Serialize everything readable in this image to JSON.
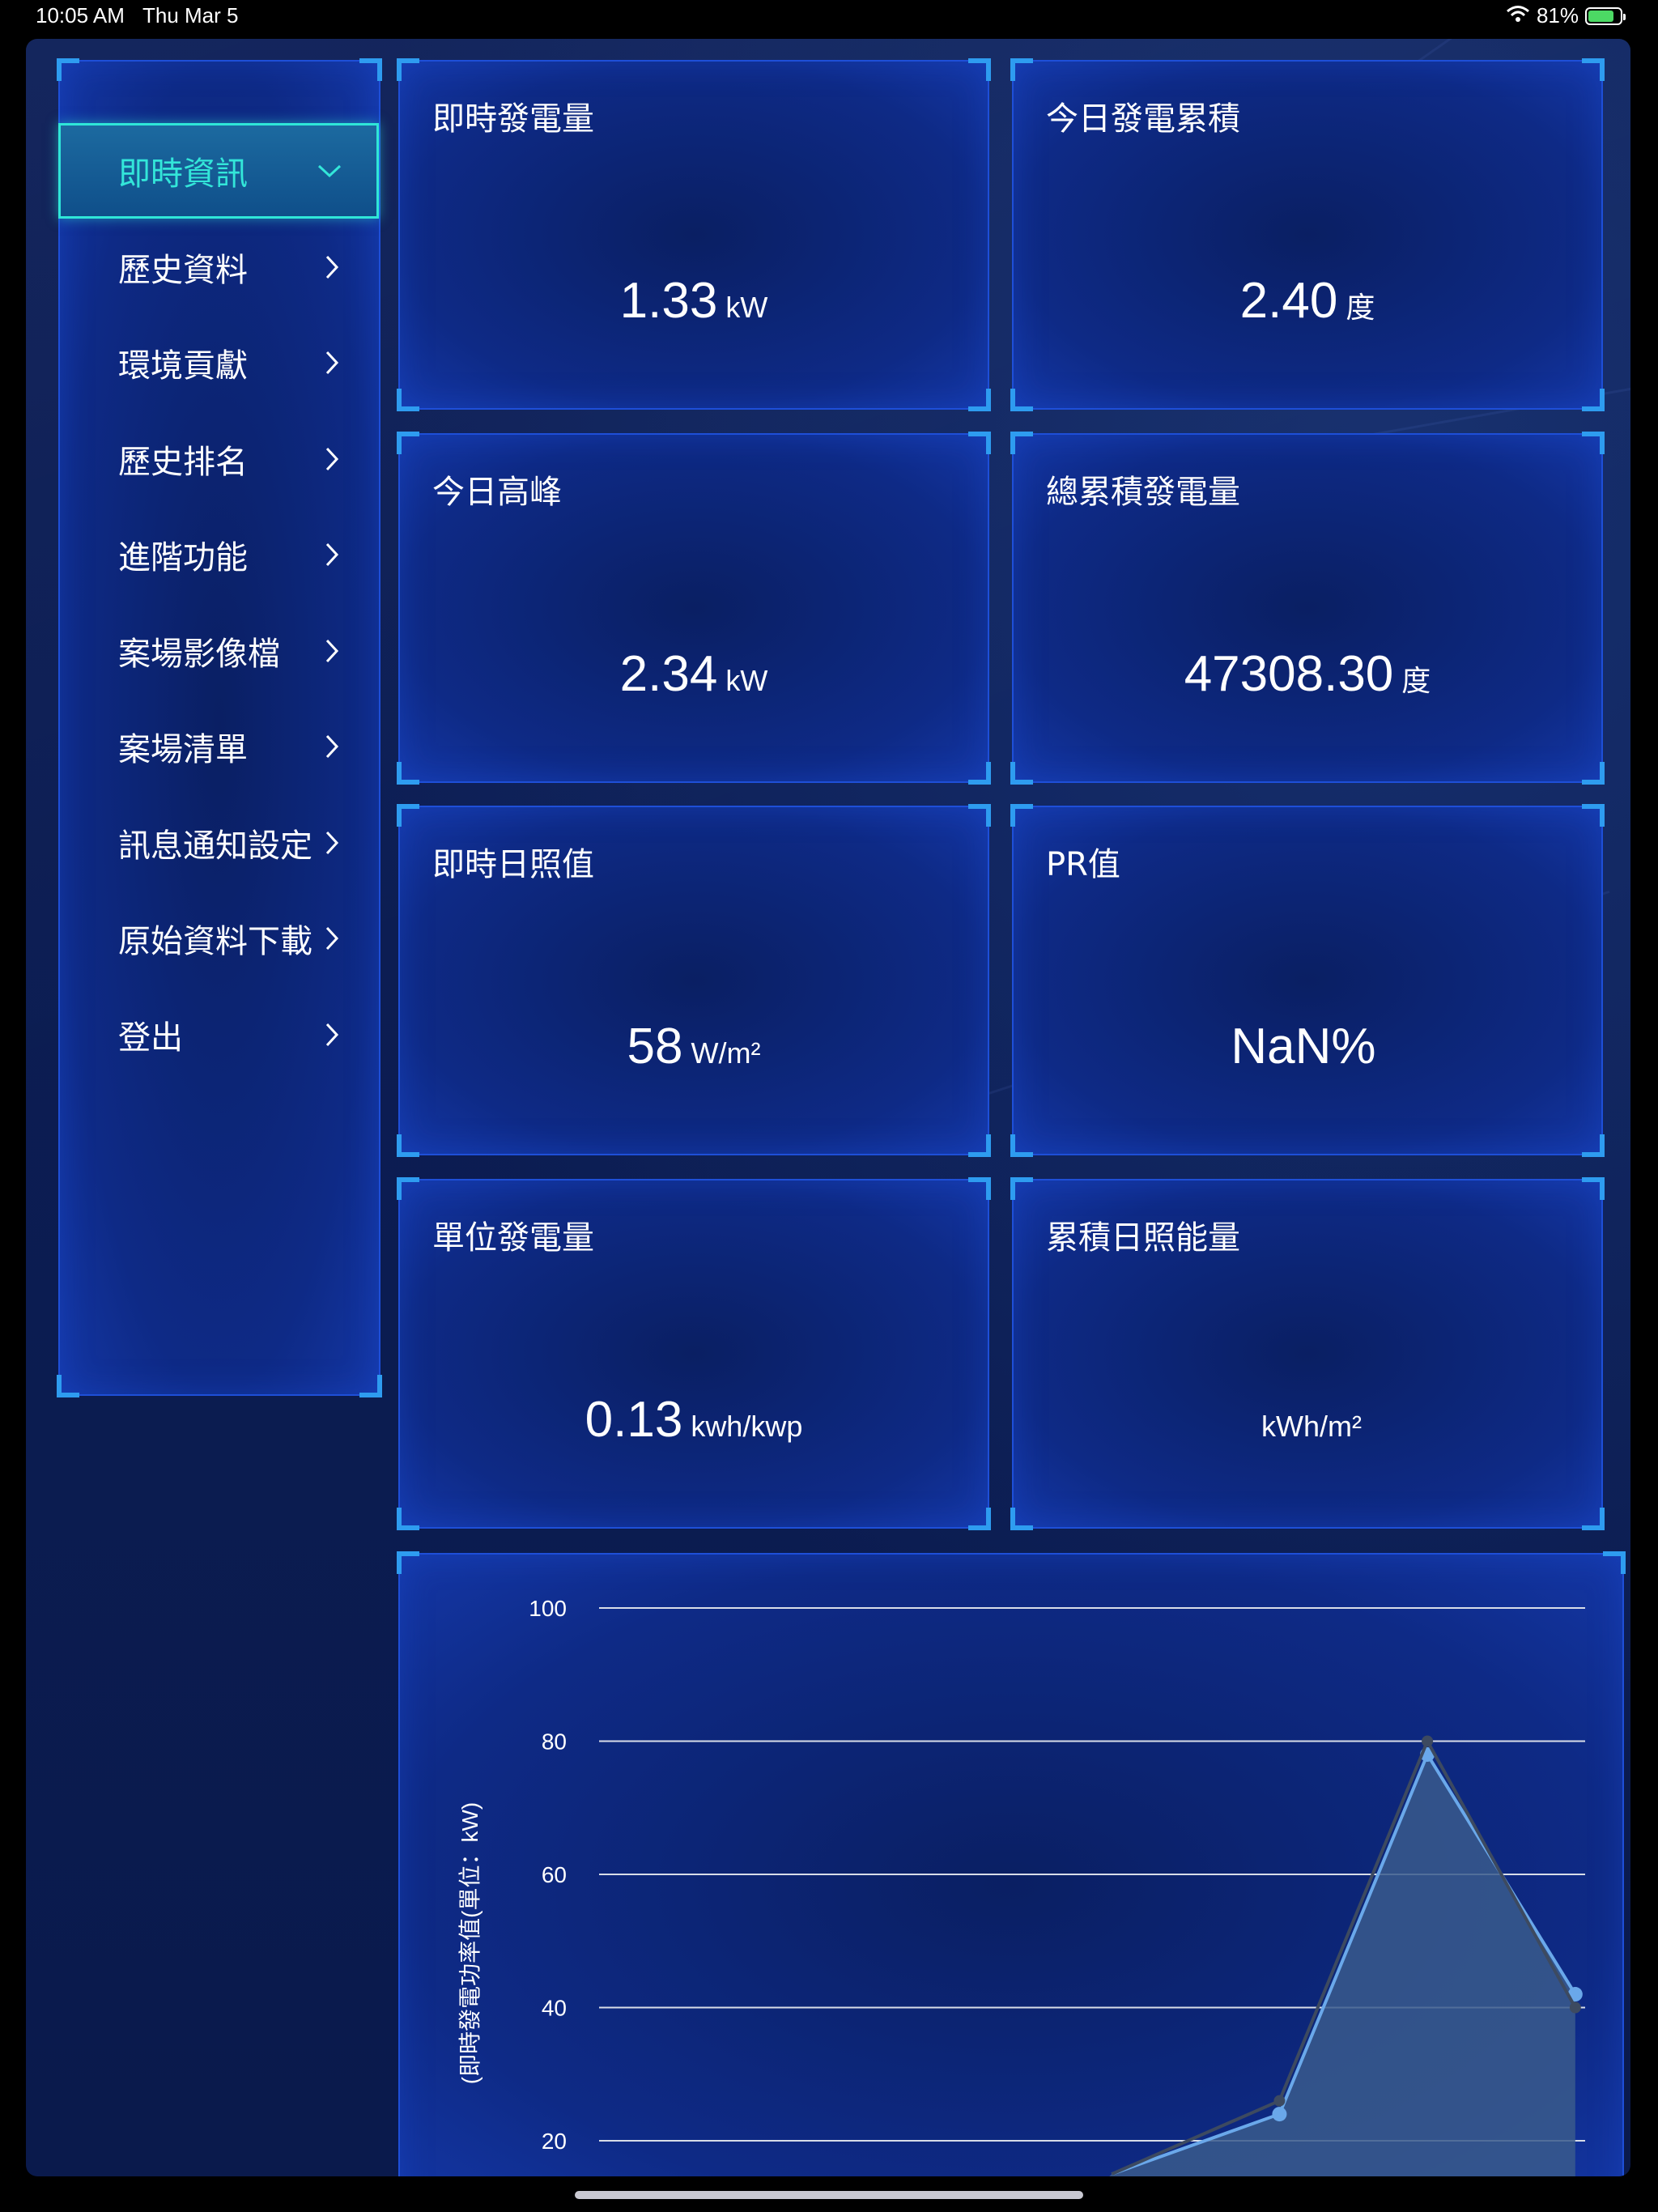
{
  "status_bar": {
    "time": "10:05 AM",
    "date": "Thu Mar 5",
    "battery": "81%",
    "battery_level": 0.81
  },
  "menu": {
    "items": [
      {
        "label": "即時資訊",
        "active": true
      },
      {
        "label": "歷史資料"
      },
      {
        "label": "環境貢獻"
      },
      {
        "label": "歷史排名"
      },
      {
        "label": "進階功能"
      },
      {
        "label": "案場影像檔"
      },
      {
        "label": "案場清單"
      },
      {
        "label": "訊息通知設定"
      },
      {
        "label": "原始資料下載"
      },
      {
        "label": "登出"
      }
    ]
  },
  "cards": [
    {
      "title": "即時發電量",
      "value": "1.33",
      "unit": "kW"
    },
    {
      "title": "今日發電累積",
      "value": "2.40",
      "unit": "度"
    },
    {
      "title": "今日高峰",
      "value": "2.34",
      "unit": "kW"
    },
    {
      "title": "總累積發電量",
      "value": "47308.30",
      "unit": "度"
    },
    {
      "title": "即時日照值",
      "value": "58",
      "unit": "W/m²"
    },
    {
      "title": "PR值",
      "value": "NaN%",
      "unit": ""
    },
    {
      "title": "單位發電量",
      "value": "0.13",
      "unit": "kwh/kwp"
    },
    {
      "title": "累積日照能量",
      "value": "",
      "unit": "kWh/m²"
    }
  ],
  "chart_data": {
    "type": "area",
    "ylabel": "(即時發電功率值(單位：kW)",
    "ylim": [
      0,
      100
    ],
    "yticks": [
      20,
      40,
      60,
      80,
      100
    ],
    "grid": true,
    "series": [
      {
        "values": [
          15,
          24,
          78,
          42
        ],
        "color": "#6aa8ea",
        "fill": "#3a5a8c"
      },
      {
        "values": [
          15,
          26,
          80,
          40
        ],
        "color": "#3d4a60"
      }
    ],
    "x_positions": [
      0.52,
      0.69,
      0.84,
      0.99
    ],
    "colors": {
      "accent": "#33e6d9",
      "border": "#1e4fd8",
      "corner": "#2e9cf0"
    }
  }
}
